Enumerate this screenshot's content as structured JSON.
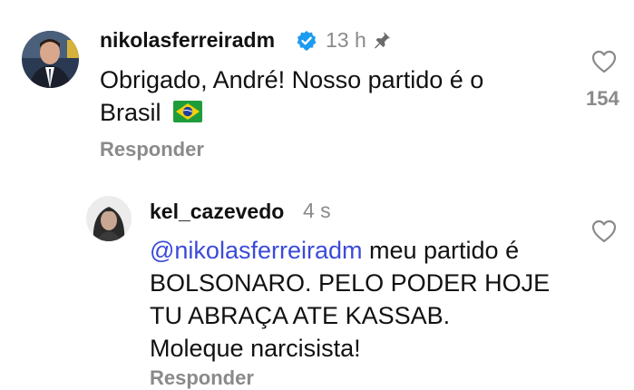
{
  "comments": [
    {
      "username": "nikolasferreiradm",
      "verified": true,
      "time": "13 h",
      "pinned": true,
      "text_line1": "Obrigado, André! Nosso partido é o",
      "text_line2": "Brasil",
      "flag_icon": "brazil-flag-icon",
      "reply_label": "Responder",
      "like_count": "154"
    },
    {
      "username": "kel_cazevedo",
      "time": "4 s",
      "mention": "@nikolasferreiradm",
      "text_after_mention": " meu partido é",
      "text_line2": "BOLSONARO. PELO PODER HOJE",
      "text_line3": "TU ABRAÇA ATE KASSAB.",
      "text_line4": "Moleque narcisista!",
      "reply_label": "Responder"
    }
  ],
  "colors": {
    "mention": "#3b4bd8",
    "verified": "#1d9bf0",
    "muted": "#8a8a8a"
  }
}
